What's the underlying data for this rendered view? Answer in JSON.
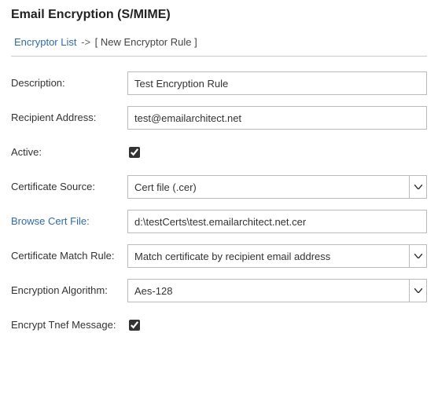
{
  "title": "Email Encryption (S/MIME)",
  "breadcrumb": {
    "link": "Encryptor List",
    "sep": "->",
    "current": "[ New Encryptor Rule ]"
  },
  "form": {
    "description": {
      "label": "Description:",
      "value": "Test Encryption Rule"
    },
    "recipient": {
      "label": "Recipient Address:",
      "value": "test@emailarchitect.net"
    },
    "active": {
      "label": "Active:",
      "checked": true
    },
    "certSource": {
      "label": "Certificate Source:",
      "value": "Cert file (.cer)"
    },
    "browseCert": {
      "label": "Browse Cert File:",
      "value": "d:\\testCerts\\test.emailarchitect.net.cer"
    },
    "matchRule": {
      "label": "Certificate Match Rule:",
      "value": "Match certificate by recipient email address"
    },
    "algorithm": {
      "label": "Encryption Algorithm:",
      "value": "Aes-128"
    },
    "encryptTnef": {
      "label": "Encrypt Tnef Message:",
      "checked": true
    }
  }
}
